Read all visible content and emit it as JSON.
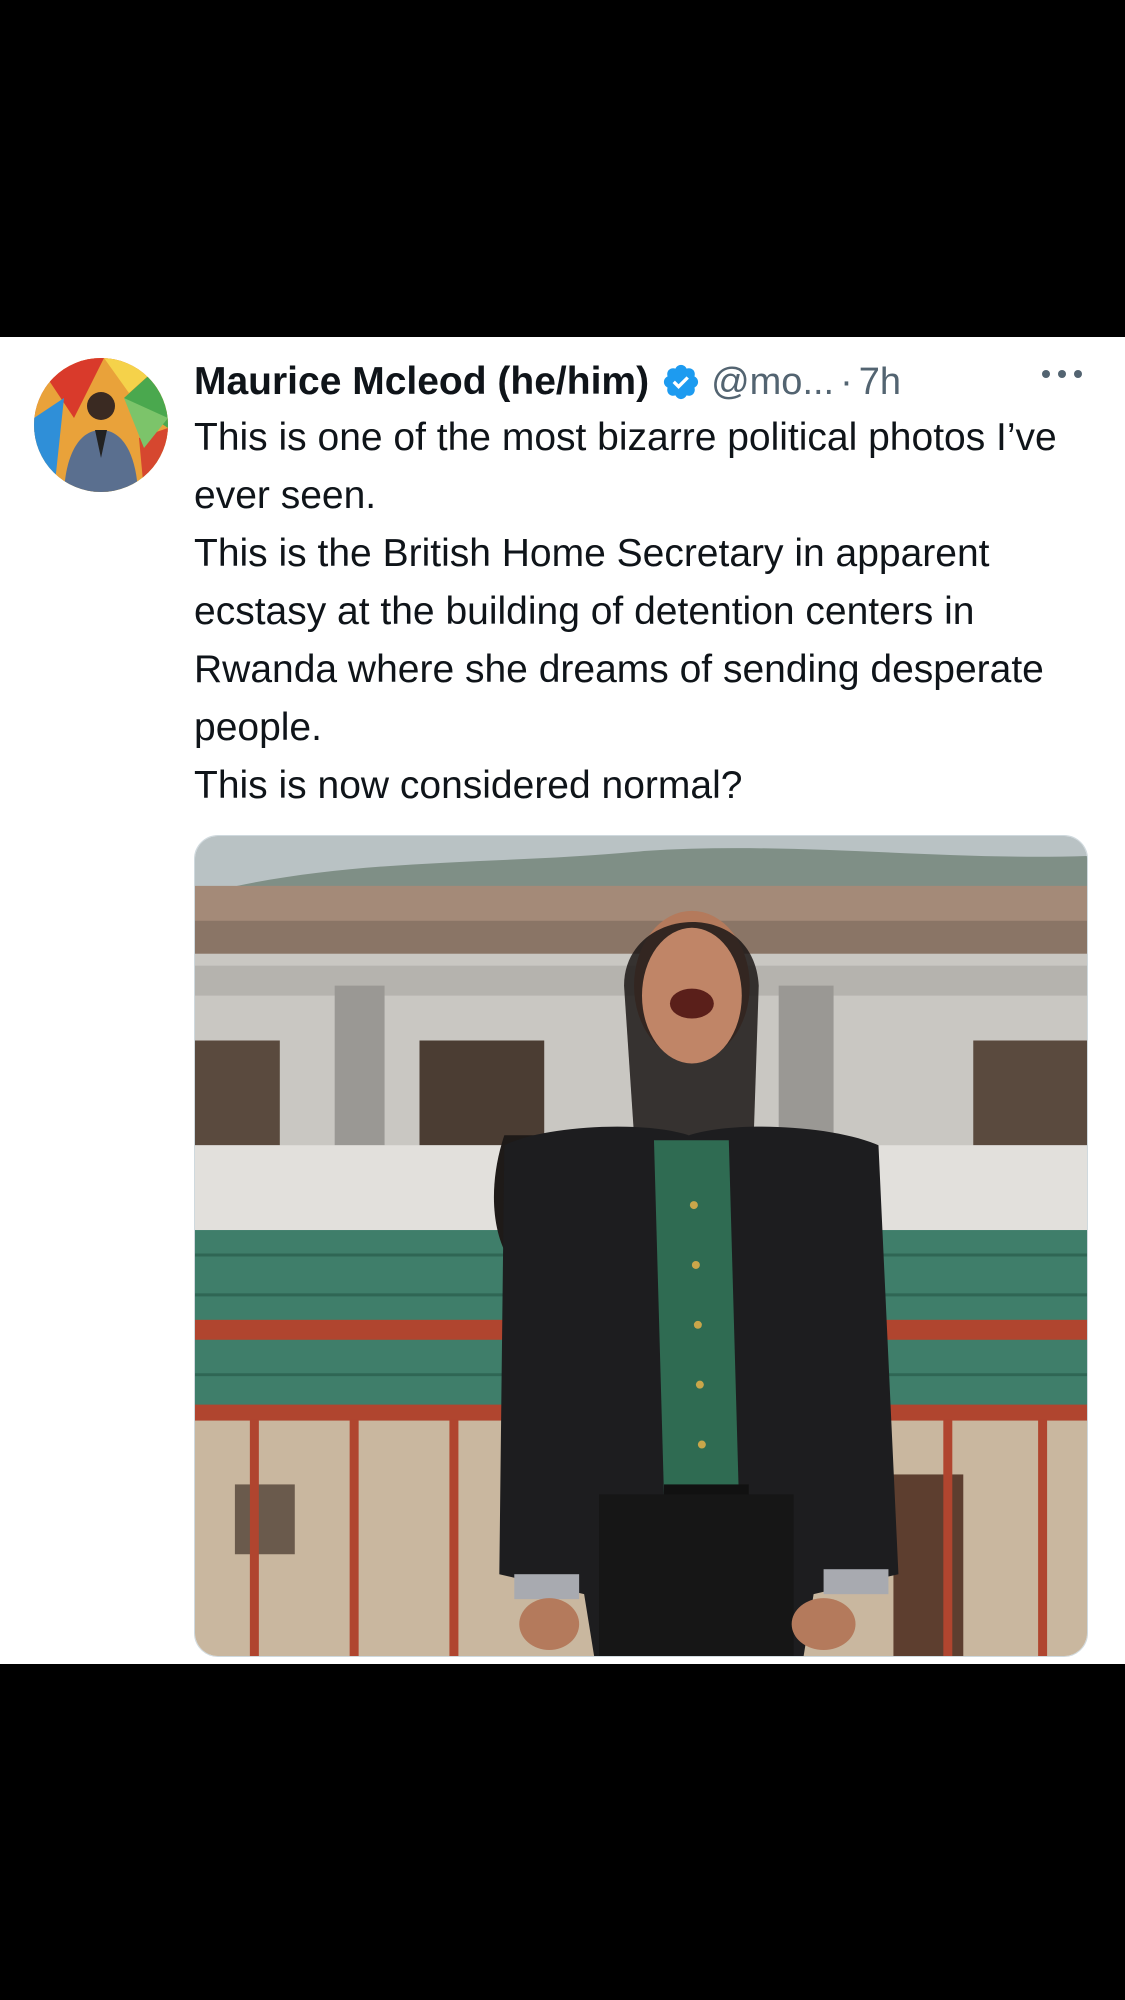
{
  "tweet": {
    "author": {
      "display_name": "Maurice Mcleod (he/him)",
      "handle": "@mo...",
      "verified_icon": "verified-badge-icon"
    },
    "separator": "·",
    "timestamp": "7h",
    "more_icon": "more-options-icon",
    "text_lines": [
      "This is one of the most bizarre political photos I’ve ever seen.",
      "This is the British Home Secretary in apparent ecstasy at the building of detention centers in Rwanda where she dreams of sending desperate people.",
      "This is now considered normal?"
    ],
    "media": {
      "type": "photo"
    }
  },
  "colors": {
    "background": "#000000",
    "card": "#ffffff",
    "text_primary": "#0f1419",
    "text_secondary": "#536471",
    "verified": "#1d9bf0"
  }
}
